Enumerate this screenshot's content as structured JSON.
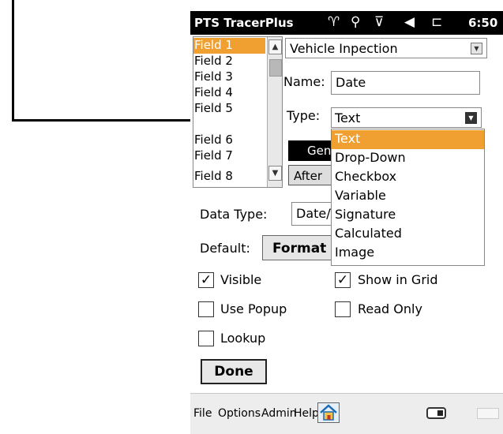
{
  "titlebar": {
    "app_title": "PTS TracerPlus",
    "time": "6:50",
    "icons": [
      "antenna-icon",
      "sync-icon",
      "no-signal-icon",
      "volume-icon",
      "battery-icon"
    ]
  },
  "fields_list": [
    "Field 1",
    "Field 2",
    "Field 3",
    "Field 4",
    "Field 5",
    "Field 6",
    "Field 7",
    "Field 8"
  ],
  "table_select": {
    "value": "Vehicle Inpection"
  },
  "name_field": {
    "label": "Name:",
    "value": "Date"
  },
  "type_field": {
    "label": "Type:",
    "value": "Text",
    "options": [
      "Text",
      "Drop-Down",
      "Checkbox",
      "Variable",
      "Signature",
      "Calculated",
      "Image"
    ]
  },
  "buttons": {
    "general": "General",
    "after": "After",
    "format": "Format",
    "done": "Done"
  },
  "data_type": {
    "label": "Data Type:",
    "value": "Date/Time"
  },
  "default": {
    "label": "Default:"
  },
  "checkboxes": {
    "visible": {
      "label": "Visible",
      "checked": true
    },
    "show_in_grid": {
      "label": "Show in Grid",
      "checked": true
    },
    "use_popup": {
      "label": "Use Popup",
      "checked": false
    },
    "read_only": {
      "label": "Read Only",
      "checked": false
    },
    "lookup": {
      "label": "Lookup",
      "checked": false
    }
  },
  "menubar": {
    "items": [
      "File",
      "Options",
      "Admin",
      "Help"
    ]
  },
  "colors": {
    "selection": "#f0a030",
    "titlebar": "#000000"
  }
}
